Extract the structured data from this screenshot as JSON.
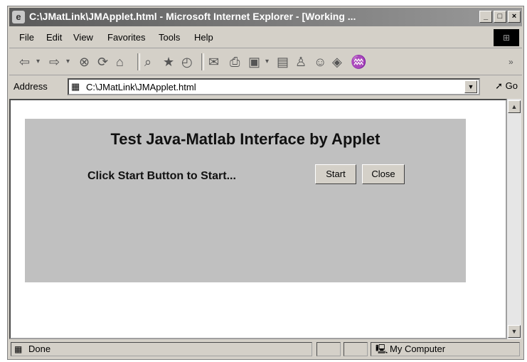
{
  "window": {
    "title": "C:\\JMatLink\\JMApplet.html - Microsoft Internet Explorer - [Working ...",
    "controls": {
      "minimize": "_",
      "maximize": "□",
      "close": "×"
    }
  },
  "menu": {
    "items": [
      "File",
      "Edit",
      "View",
      "Favorites",
      "Tools",
      "Help"
    ]
  },
  "toolbar": {
    "icons": [
      "back-icon",
      "dropdown-icon",
      "forward-icon",
      "dropdown-icon",
      "stop-icon",
      "refresh-icon",
      "home-icon",
      "search-icon",
      "favorites-icon",
      "history-icon",
      "mail-icon",
      "print-icon",
      "edit-icon",
      "dropdown-icon",
      "discuss-icon",
      "research-icon",
      "messenger-icon",
      "media-icon",
      "chevron-icon"
    ]
  },
  "address": {
    "label": "Address",
    "value": "C:\\JMatLink\\JMApplet.html",
    "go_label": "Go"
  },
  "applet": {
    "title": "Test Java-Matlab Interface by Applet",
    "prompt": "Click Start Button to Start...",
    "start_label": "Start",
    "close_label": "Close"
  },
  "status": {
    "text": "Done",
    "zone": "My Computer"
  }
}
